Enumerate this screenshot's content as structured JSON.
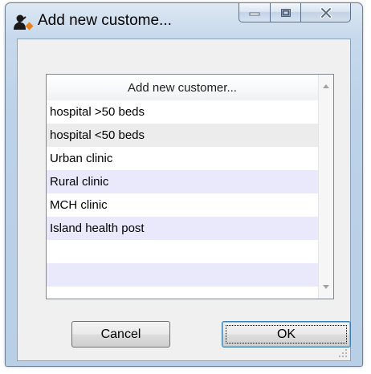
{
  "window": {
    "title": "Add new custome...",
    "icon": "customer-icon",
    "caption_buttons": [
      "minimize-icon",
      "maximize-icon",
      "close-icon"
    ]
  },
  "list": {
    "header": "Add new customer...",
    "items": [
      {
        "label": "hospital >50 beds"
      },
      {
        "label": "hospital <50 beds"
      },
      {
        "label": "Urban clinic"
      },
      {
        "label": "Rural clinic"
      },
      {
        "label": "MCH clinic"
      },
      {
        "label": "Island health post"
      },
      {
        "label": ""
      },
      {
        "label": ""
      }
    ]
  },
  "buttons": {
    "cancel_label": "Cancel",
    "ok_label": "OK"
  },
  "colors": {
    "row_alt_blue": "#e9e9fb",
    "row_grey": "#ececec",
    "frame": "#bdd2e8"
  }
}
